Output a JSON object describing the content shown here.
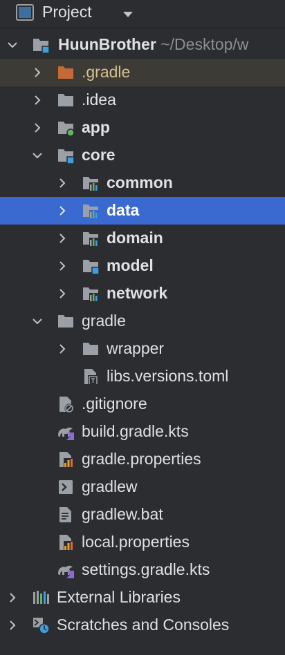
{
  "header": {
    "title": "Project"
  },
  "tree": {
    "root": {
      "name": "HuunBrother",
      "path": "~/Desktop/w"
    },
    "gradle_dir": ".gradle",
    "idea_dir": ".idea",
    "app": "app",
    "core": "core",
    "common": "common",
    "data": "data",
    "domain": "domain",
    "model": "model",
    "network": "network",
    "gradle": "gradle",
    "wrapper": "wrapper",
    "libs_versions": "libs.versions.toml",
    "gitignore": ".gitignore",
    "build_gradle": "build.gradle.kts",
    "gradle_properties": "gradle.properties",
    "gradlew": "gradlew",
    "gradlew_bat": "gradlew.bat",
    "local_properties": "local.properties",
    "settings_gradle": "settings.gradle.kts",
    "external_libraries": "External Libraries",
    "scratches": "Scratches and Consoles"
  },
  "colors": {
    "background": "#2b2d30",
    "selection": "#3a69cf",
    "ignored_row": "#3d3b35",
    "folder": "#9aa0a6",
    "excluded_folder": "#c26a38",
    "module_badge": "#3d9ee0",
    "android_badge": "#5fb75f"
  }
}
